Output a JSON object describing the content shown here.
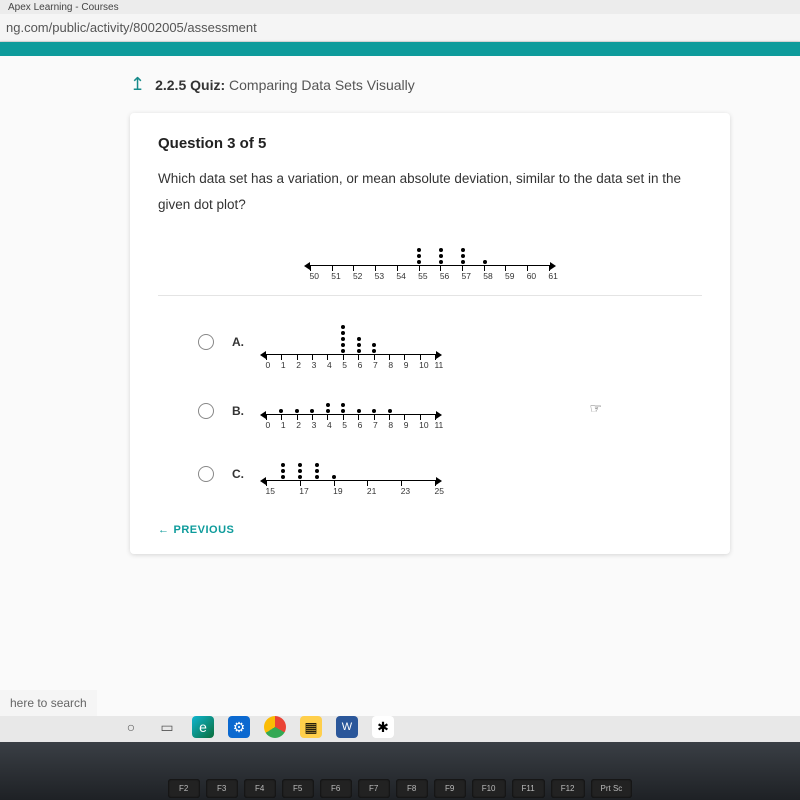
{
  "browser": {
    "tab_title": "Apex Learning - Courses",
    "url": "ng.com/public/activity/8002005/assessment"
  },
  "quiz_header": {
    "code": "2.2.5",
    "label": "Quiz:",
    "title": "Comparing Data Sets Visually"
  },
  "question": {
    "number_label": "Question 3 of 5",
    "text": "Which data set has a variation, or mean absolute deviation, similar to the data set in the given dot plot?"
  },
  "options": {
    "a_label": "A.",
    "b_label": "B.",
    "c_label": "C."
  },
  "prev_label": "PREVIOUS",
  "search_hint": "here to search",
  "chart_data": [
    {
      "name": "given",
      "type": "dotplot",
      "axis": {
        "min": 50,
        "max": 61,
        "ticks": [
          50,
          51,
          52,
          53,
          54,
          55,
          56,
          57,
          58,
          59,
          60,
          61
        ]
      },
      "counts": {
        "55": 3,
        "56": 3,
        "57": 3,
        "58": 1
      }
    },
    {
      "name": "option_a",
      "type": "dotplot",
      "axis": {
        "min": 0,
        "max": 11,
        "ticks": [
          0,
          1,
          2,
          3,
          4,
          5,
          6,
          7,
          8,
          9,
          10,
          11
        ]
      },
      "counts": {
        "5": 5,
        "6": 3,
        "7": 2
      }
    },
    {
      "name": "option_b",
      "type": "dotplot",
      "axis": {
        "min": 0,
        "max": 11,
        "ticks": [
          0,
          1,
          2,
          3,
          4,
          5,
          6,
          7,
          8,
          9,
          10,
          11
        ]
      },
      "counts": {
        "1": 1,
        "2": 1,
        "3": 1,
        "4": 2,
        "5": 2,
        "6": 1,
        "7": 1,
        "8": 1
      }
    },
    {
      "name": "option_c",
      "type": "dotplot",
      "axis": {
        "min": 15,
        "max": 25,
        "ticks": [
          15,
          17,
          19,
          21,
          23,
          25
        ]
      },
      "counts": {
        "16": 3,
        "17": 3,
        "18": 3,
        "19": 1
      }
    }
  ],
  "keys": [
    "F2",
    "F3",
    "F4",
    "F5",
    "F6",
    "F7",
    "F8",
    "F9",
    "F10",
    "F11",
    "F12",
    "Prt Sc"
  ]
}
